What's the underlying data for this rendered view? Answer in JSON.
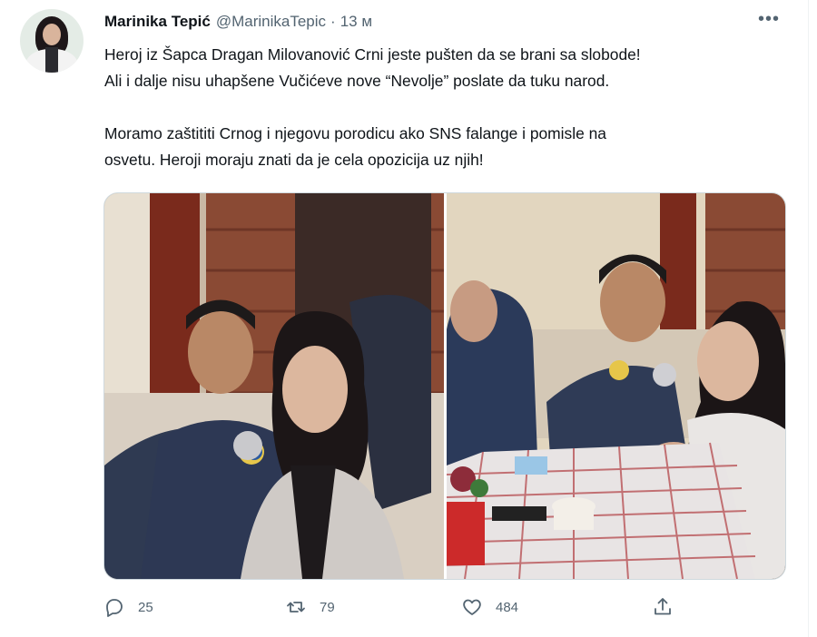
{
  "tweet": {
    "author_name": "Marinika Tepić",
    "author_handle": "@MarinikaTepic",
    "separator": "·",
    "time": "13 м",
    "more_label": "•••",
    "text_lines": [
      "Heroj iz Šapca Dragan Milovanović Crni jeste pušten da se brani sa slobode!",
      "Ali i dalje nisu uhapšene Vučićeve nove “Nevolje” poslate da tuku narod.",
      "",
      "Moramo zaštititi Crnog i njegovu porodicu ako SNS falange i pomisle na",
      "osvetu. Heroji moraju znati da je cela opozicija uz njih!"
    ]
  },
  "actions": {
    "reply_count": "25",
    "retweet_count": "79",
    "like_count": "484"
  },
  "icons": {
    "reply": "reply-icon",
    "retweet": "retweet-icon",
    "like": "heart-icon",
    "share": "share-icon",
    "more": "more-icon"
  },
  "colors": {
    "text_primary": "#0f1419",
    "text_secondary": "#536471",
    "border": "#cfd9de"
  }
}
